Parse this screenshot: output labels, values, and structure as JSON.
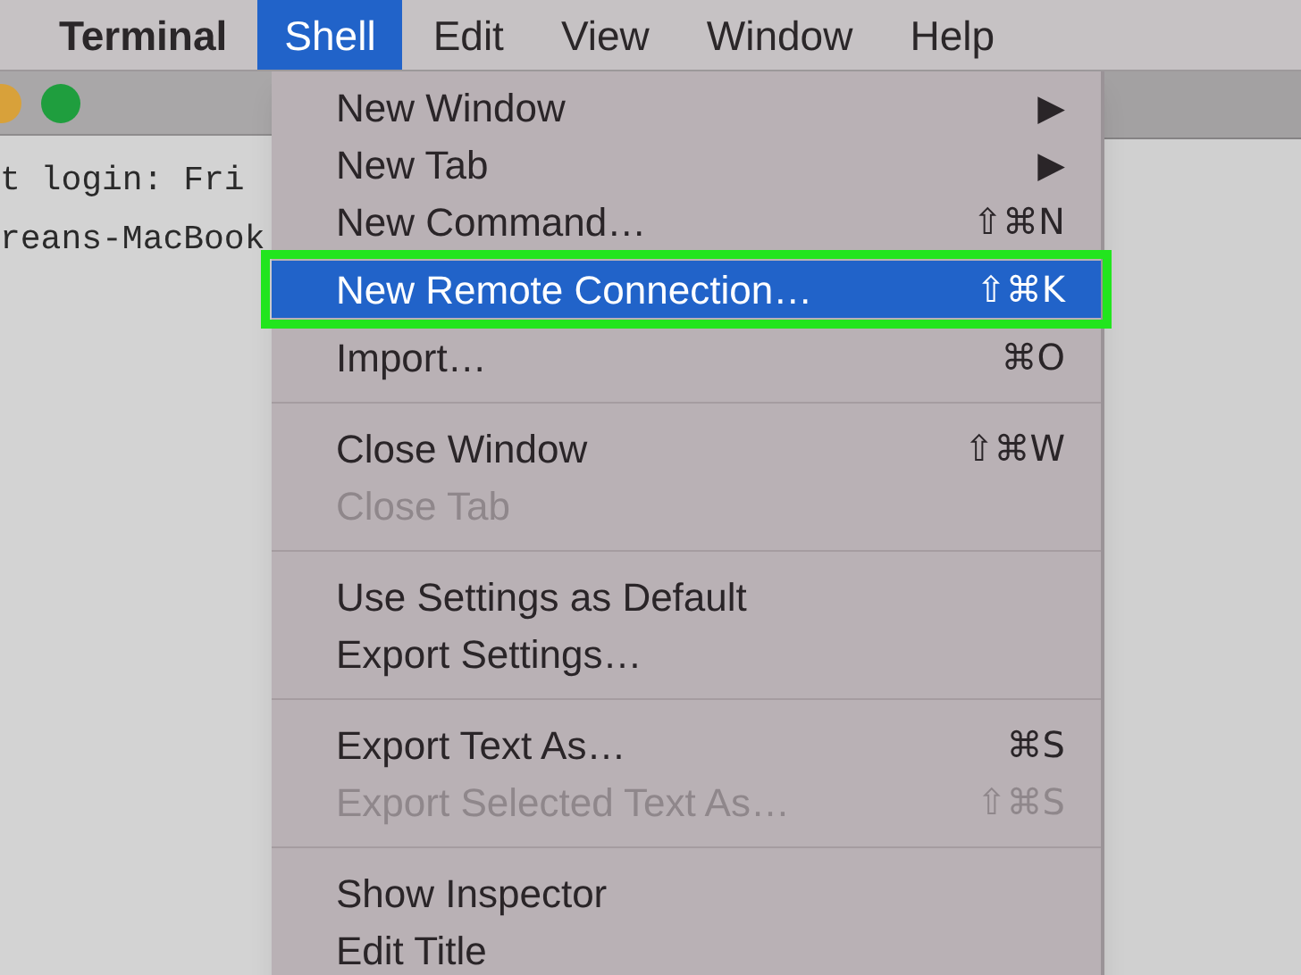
{
  "menubar": {
    "items": [
      {
        "label": "Terminal",
        "kind": "app",
        "selected": false
      },
      {
        "label": "Shell",
        "kind": "menu",
        "selected": true
      },
      {
        "label": "Edit",
        "kind": "menu",
        "selected": false
      },
      {
        "label": "View",
        "kind": "menu",
        "selected": false
      },
      {
        "label": "Window",
        "kind": "menu",
        "selected": false
      },
      {
        "label": "Help",
        "kind": "menu",
        "selected": false
      }
    ]
  },
  "terminal_window": {
    "lines": [
      "t login: Fri",
      "reans-MacBook"
    ]
  },
  "menu": {
    "sections": [
      [
        {
          "label": "New Window",
          "shortcut": "▶",
          "disabled": false,
          "selected": false
        },
        {
          "label": "New Tab",
          "shortcut": "▶",
          "disabled": false,
          "selected": false
        },
        {
          "label": "New Command…",
          "shortcut": "⇧⌘N",
          "disabled": false,
          "selected": false
        },
        {
          "label": "New Remote Connection…",
          "shortcut": "⇧⌘K",
          "disabled": false,
          "selected": true
        },
        {
          "label": "Import…",
          "shortcut": "⌘O",
          "disabled": false,
          "selected": false
        }
      ],
      [
        {
          "label": "Close Window",
          "shortcut": "⇧⌘W",
          "disabled": false,
          "selected": false
        },
        {
          "label": "Close Tab",
          "disabled": true,
          "selected": false
        }
      ],
      [
        {
          "label": "Use Settings as Default",
          "disabled": false,
          "selected": false
        },
        {
          "label": "Export Settings…",
          "disabled": false,
          "selected": false
        }
      ],
      [
        {
          "label": "Export Text As…",
          "shortcut": "⌘S",
          "disabled": false,
          "selected": false
        },
        {
          "label": "Export Selected Text As…",
          "shortcut": "⇧⌘S",
          "disabled": true,
          "selected": false
        }
      ],
      [
        {
          "label": "Show Inspector",
          "disabled": false,
          "selected": false
        },
        {
          "label": "Edit Title",
          "disabled": false,
          "selected": false
        }
      ]
    ]
  }
}
